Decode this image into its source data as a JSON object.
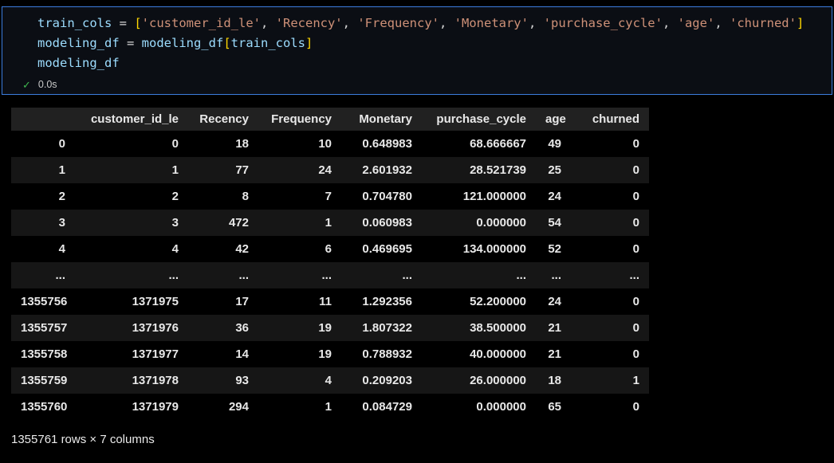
{
  "colors": {
    "variable": "#9CDCFE",
    "operator": "#D4D4D4",
    "string": "#CE9178",
    "bracket": "#FFD700",
    "success": "#3FB950",
    "cell_border": "#3C7DDE",
    "cell_bg": "#0B0E14"
  },
  "cell": {
    "exec_time": "0.0s",
    "check_icon": "✓",
    "code_lines": [
      [
        {
          "text": "train_cols",
          "type": "var"
        },
        {
          "text": " = ",
          "type": "op"
        },
        {
          "text": "[",
          "type": "brk"
        },
        {
          "text": "'customer_id_le'",
          "type": "str"
        },
        {
          "text": ", ",
          "type": "op"
        },
        {
          "text": "'Recency'",
          "type": "str"
        },
        {
          "text": ", ",
          "type": "op"
        },
        {
          "text": "'Frequency'",
          "type": "str"
        },
        {
          "text": ", ",
          "type": "op"
        },
        {
          "text": "'Monetary'",
          "type": "str"
        },
        {
          "text": ", ",
          "type": "op"
        },
        {
          "text": "'purchase_cycle'",
          "type": "str"
        },
        {
          "text": ", ",
          "type": "op"
        },
        {
          "text": "'age'",
          "type": "str"
        },
        {
          "text": ", ",
          "type": "op"
        },
        {
          "text": "'churned'",
          "type": "str"
        },
        {
          "text": "]",
          "type": "brk"
        }
      ],
      [
        {
          "text": "modeling_df",
          "type": "var"
        },
        {
          "text": " = ",
          "type": "op"
        },
        {
          "text": "modeling_df",
          "type": "var"
        },
        {
          "text": "[",
          "type": "brk"
        },
        {
          "text": "train_cols",
          "type": "var"
        },
        {
          "text": "]",
          "type": "brk"
        }
      ],
      [
        {
          "text": "modeling_df",
          "type": "var"
        }
      ]
    ]
  },
  "table": {
    "headers": [
      "",
      "customer_id_le",
      "Recency",
      "Frequency",
      "Monetary",
      "purchase_cycle",
      "age",
      "churned"
    ],
    "rows": [
      [
        "0",
        "0",
        "18",
        "10",
        "0.648983",
        "68.666667",
        "49",
        "0"
      ],
      [
        "1",
        "1",
        "77",
        "24",
        "2.601932",
        "28.521739",
        "25",
        "0"
      ],
      [
        "2",
        "2",
        "8",
        "7",
        "0.704780",
        "121.000000",
        "24",
        "0"
      ],
      [
        "3",
        "3",
        "472",
        "1",
        "0.060983",
        "0.000000",
        "54",
        "0"
      ],
      [
        "4",
        "4",
        "42",
        "6",
        "0.469695",
        "134.000000",
        "52",
        "0"
      ],
      [
        "...",
        "...",
        "...",
        "...",
        "...",
        "...",
        "...",
        "..."
      ],
      [
        "1355756",
        "1371975",
        "17",
        "11",
        "1.292356",
        "52.200000",
        "24",
        "0"
      ],
      [
        "1355757",
        "1371976",
        "36",
        "19",
        "1.807322",
        "38.500000",
        "21",
        "0"
      ],
      [
        "1355758",
        "1371977",
        "14",
        "19",
        "0.788932",
        "40.000000",
        "21",
        "0"
      ],
      [
        "1355759",
        "1371978",
        "93",
        "4",
        "0.209203",
        "26.000000",
        "18",
        "1"
      ],
      [
        "1355760",
        "1371979",
        "294",
        "1",
        "0.084729",
        "0.000000",
        "65",
        "0"
      ]
    ],
    "footer": "1355761 rows × 7 columns"
  }
}
